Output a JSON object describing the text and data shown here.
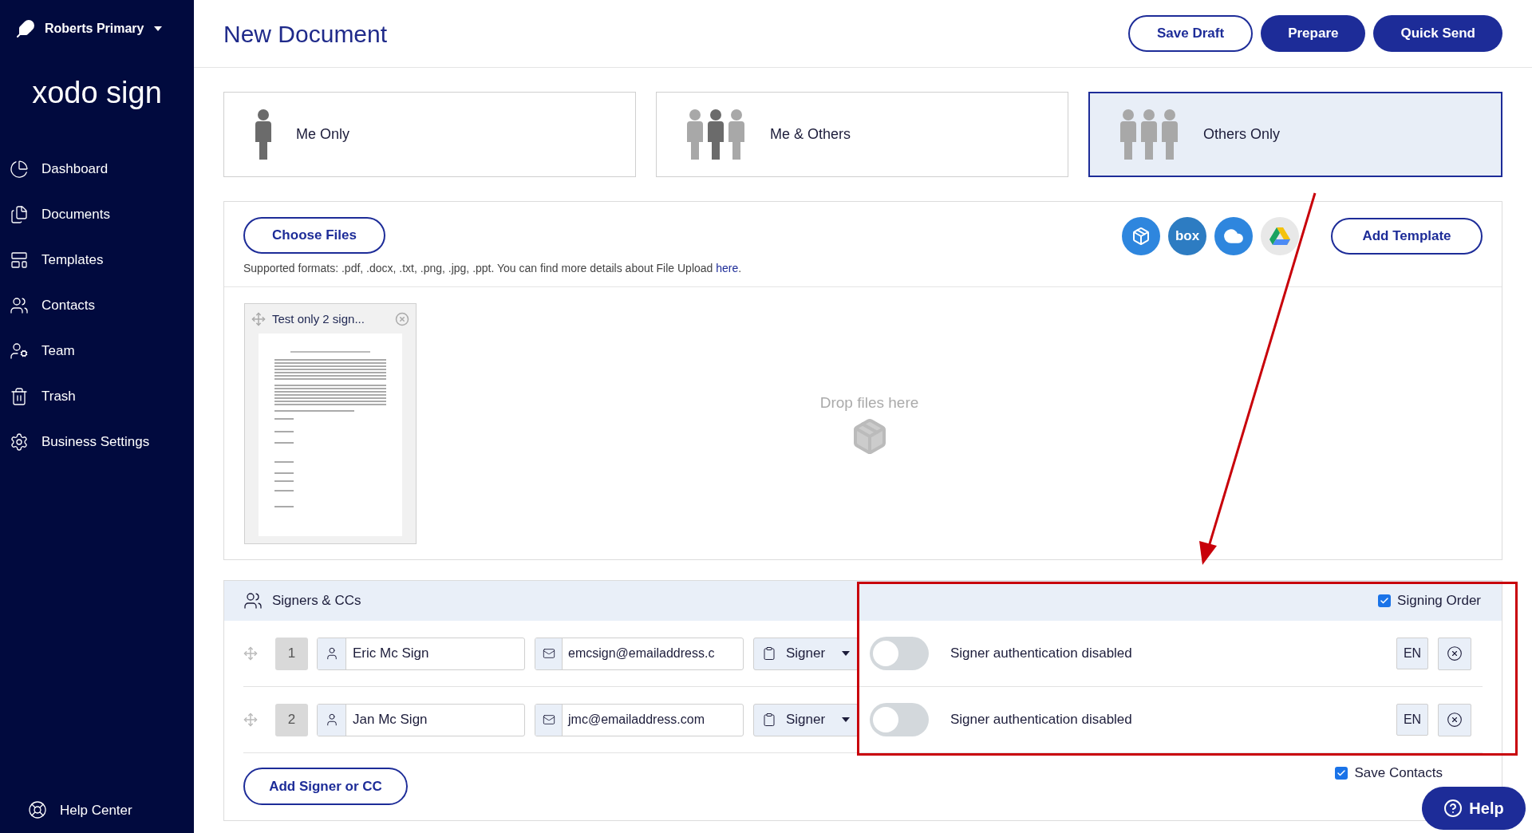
{
  "sidebar": {
    "account": "Roberts Primary",
    "logo": "xodo sign",
    "items": [
      {
        "label": "Dashboard",
        "kind": "dashboard"
      },
      {
        "label": "Documents",
        "kind": "documents"
      },
      {
        "label": "Templates",
        "kind": "templates"
      },
      {
        "label": "Contacts",
        "kind": "contacts"
      },
      {
        "label": "Team",
        "kind": "team"
      },
      {
        "label": "Trash",
        "kind": "trash"
      },
      {
        "label": "Business Settings",
        "kind": "settings"
      }
    ],
    "help_center": "Help Center"
  },
  "header": {
    "title": "New Document",
    "buttons": [
      {
        "label": "Save Draft",
        "kind": "outline"
      },
      {
        "label": "Prepare",
        "kind": "primary"
      },
      {
        "label": "Quick Send",
        "kind": "primary"
      }
    ]
  },
  "recipient_modes": [
    {
      "label": "Me Only",
      "kind": "me",
      "selected": false
    },
    {
      "label": "Me & Others",
      "kind": "me_others",
      "selected": false
    },
    {
      "label": "Others Only",
      "kind": "others",
      "selected": true
    }
  ],
  "upload": {
    "choose_button": "Choose Files",
    "hint": "Supported formats: .pdf, .docx, .txt, .png, .jpg, .ppt. You can find more details about File Upload ",
    "hint_link": "here",
    "hint_end": ".",
    "cloud_services": [
      {
        "kind": "dropbox"
      },
      {
        "kind": "box",
        "label": "box"
      },
      {
        "kind": "onedrive"
      },
      {
        "kind": "drive"
      }
    ],
    "add_template": "Add Template",
    "file": {
      "name": "Test only 2 sign..."
    },
    "drop_text": "Drop files here"
  },
  "signers": {
    "title": "Signers & CCs",
    "signing_order": {
      "label": "Signing Order",
      "checked": true
    },
    "rows": [
      {
        "number": "1",
        "name": "Eric Mc Sign",
        "email": "emcsign@emailaddress.c",
        "role": "Signer",
        "auth_on": false,
        "auth_label": "Signer authentication disabled",
        "language": "EN"
      },
      {
        "number": "2",
        "name": "Jan Mc Sign",
        "email": "jmc@emailaddress.com",
        "role": "Signer",
        "auth_on": false,
        "auth_label": "Signer authentication disabled",
        "language": "EN"
      }
    ],
    "add_button": "Add Signer or CC",
    "save_contacts": {
      "label": "Save Contacts",
      "checked": true
    }
  },
  "help_button": "Help"
}
